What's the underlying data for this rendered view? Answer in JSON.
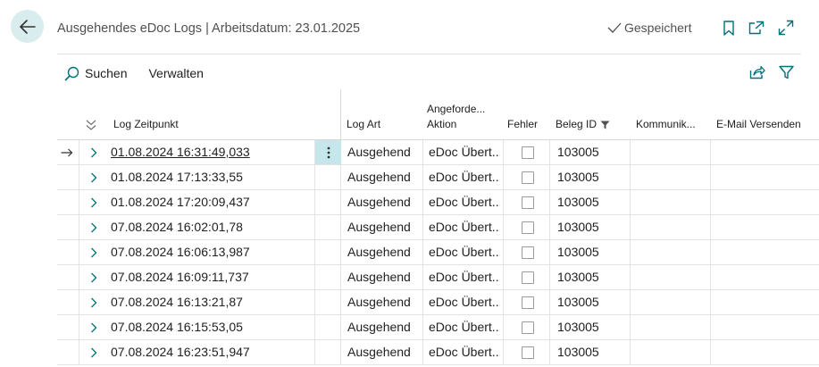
{
  "header": {
    "title": "Ausgehendes eDoc Logs | Arbeitsdatum: 23.01.2025",
    "saved_label": "Gespeichert"
  },
  "toolbar": {
    "search_label": "Suchen",
    "manage_label": "Verwalten"
  },
  "columns": {
    "log_time": "Log Zeitpunkt",
    "log_type": "Log Art",
    "action_line1": "Angeforde...",
    "action_line2": "Aktion",
    "error": "Fehler",
    "doc_id": "Beleg ID",
    "communication": "Kommunik...",
    "email_send": "E-Mail Versenden"
  },
  "rows": [
    {
      "time": "01.08.2024 16:31:49,033",
      "type": "Ausgehend",
      "action": "eDoc Übert...",
      "error": false,
      "doc_id": "103005",
      "selected": true
    },
    {
      "time": "01.08.2024 17:13:33,55",
      "type": "Ausgehend",
      "action": "eDoc Übert...",
      "error": false,
      "doc_id": "103005"
    },
    {
      "time": "01.08.2024 17:20:09,437",
      "type": "Ausgehend",
      "action": "eDoc Übert...",
      "error": false,
      "doc_id": "103005"
    },
    {
      "time": "07.08.2024 16:02:01,78",
      "type": "Ausgehend",
      "action": "eDoc Übert...",
      "error": false,
      "doc_id": "103005"
    },
    {
      "time": "07.08.2024 16:06:13,987",
      "type": "Ausgehend",
      "action": "eDoc Übert...",
      "error": false,
      "doc_id": "103005"
    },
    {
      "time": "07.08.2024 16:09:11,737",
      "type": "Ausgehend",
      "action": "eDoc Übert...",
      "error": false,
      "doc_id": "103005"
    },
    {
      "time": "07.08.2024 16:13:21,87",
      "type": "Ausgehend",
      "action": "eDoc Übert...",
      "error": false,
      "doc_id": "103005"
    },
    {
      "time": "07.08.2024 16:15:53,05",
      "type": "Ausgehend",
      "action": "eDoc Übert...",
      "error": false,
      "doc_id": "103005"
    },
    {
      "time": "07.08.2024 16:23:51,947",
      "type": "Ausgehend",
      "action": "eDoc Übert...",
      "error": false,
      "doc_id": "103005"
    }
  ],
  "colors": {
    "accent": "#00707a",
    "back_button_bg": "#d9ecee",
    "selected_cell_bg": "#c5e6ea"
  },
  "icons": [
    "back-arrow-icon",
    "checkmark-icon",
    "bookmark-icon",
    "open-in-new-icon",
    "expand-icon",
    "search-icon",
    "share-icon",
    "filter-icon",
    "collapse-all-icon",
    "row-pointer-icon",
    "chevron-right-icon",
    "more-options-icon",
    "column-filter-icon"
  ]
}
